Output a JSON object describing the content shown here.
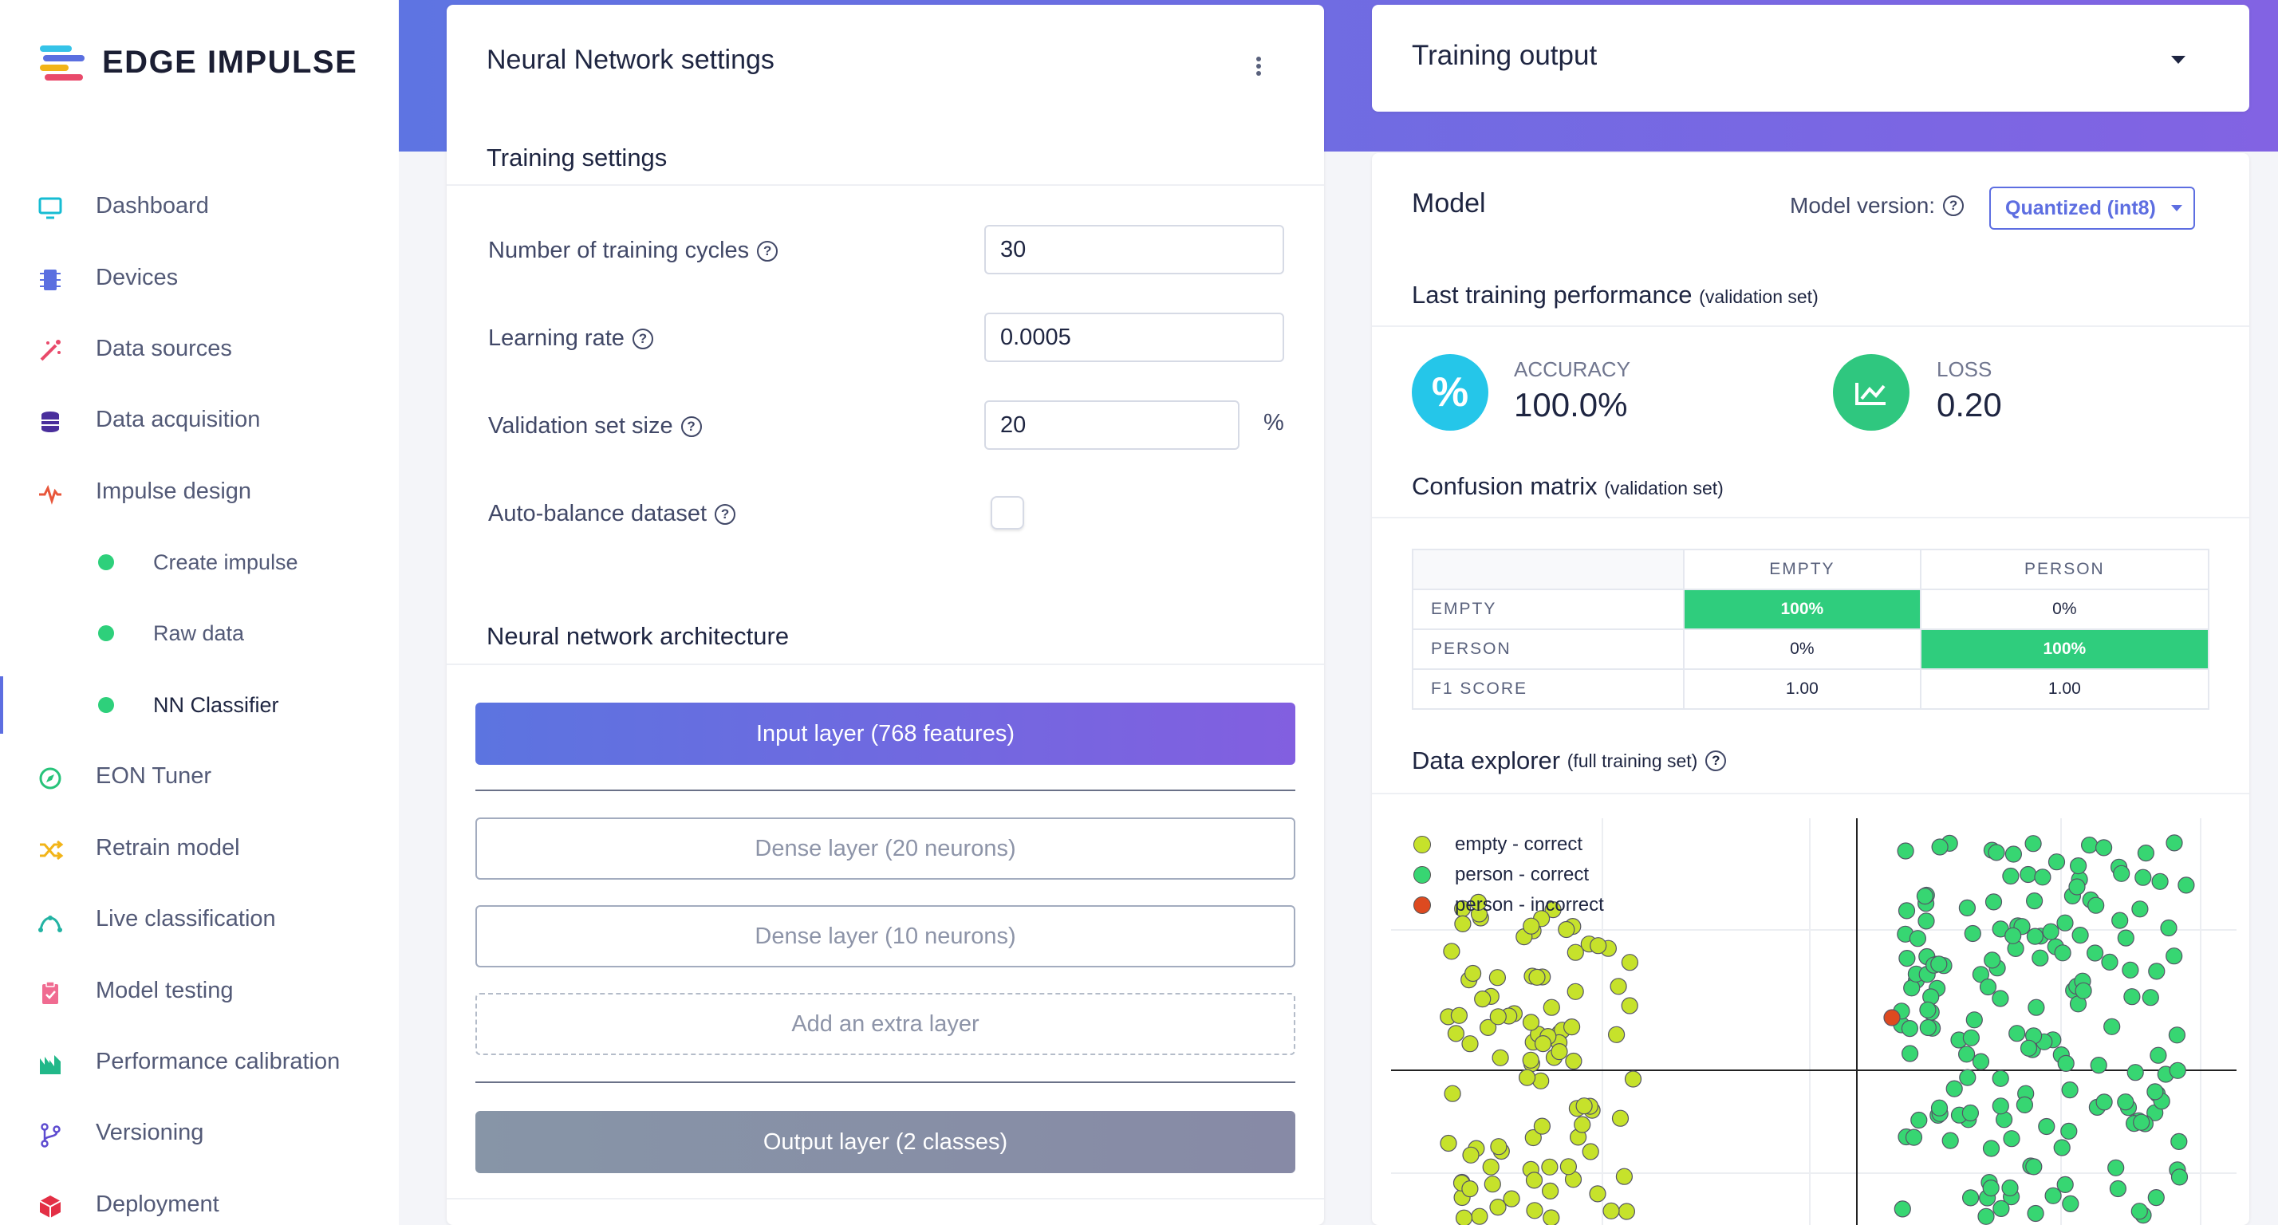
{
  "app": {
    "name": "EDGE IMPULSE"
  },
  "sidebar": {
    "items": [
      {
        "label": "Dashboard",
        "icon": "monitor-icon",
        "color": "#16bcd3"
      },
      {
        "label": "Devices",
        "icon": "chip-icon",
        "color": "#5b6fe0"
      },
      {
        "label": "Data sources",
        "icon": "magic-wand-icon",
        "color": "#e94a6b"
      },
      {
        "label": "Data acquisition",
        "icon": "database-icon",
        "color": "#4a2f9c"
      },
      {
        "label": "Impulse design",
        "icon": "pulse-icon",
        "color": "#e8563a"
      },
      {
        "label": "Create impulse",
        "sub": true
      },
      {
        "label": "Raw data",
        "sub": true
      },
      {
        "label": "NN Classifier",
        "sub": true,
        "active": true
      },
      {
        "label": "EON Tuner",
        "icon": "compass-icon",
        "color": "#27c37a"
      },
      {
        "label": "Retrain model",
        "icon": "shuffle-icon",
        "color": "#f2b418"
      },
      {
        "label": "Live classification",
        "icon": "curve-icon",
        "color": "#23b3a3"
      },
      {
        "label": "Model testing",
        "icon": "clipboard-icon",
        "color": "#f06b91"
      },
      {
        "label": "Performance calibration",
        "icon": "bar-chart-icon",
        "color": "#21b889"
      },
      {
        "label": "Versioning",
        "icon": "branch-icon",
        "color": "#5d4bd0"
      },
      {
        "label": "Deployment",
        "icon": "cube-icon",
        "color": "#e32f45"
      }
    ]
  },
  "nn": {
    "title": "Neural Network settings",
    "training_settings": "Training settings",
    "cycles_label": "Number of training cycles",
    "cycles_value": "30",
    "lr_label": "Learning rate",
    "lr_value": "0.0005",
    "val_label": "Validation set size",
    "val_value": "20",
    "val_unit": "%",
    "balance_label": "Auto-balance dataset",
    "arch_title": "Neural network architecture",
    "layers": {
      "input": "Input layer (768 features)",
      "dense1": "Dense layer (20 neurons)",
      "dense2": "Dense layer (10 neurons)",
      "add": "Add an extra layer",
      "output": "Output layer (2 classes)"
    }
  },
  "output": {
    "title": "Training output"
  },
  "model": {
    "title": "Model",
    "version_label": "Model version:",
    "version_value": "Quantized (int8)",
    "perf_title": "Last training performance",
    "perf_note": "(validation set)",
    "accuracy_label": "ACCURACY",
    "accuracy_value": "100.0%",
    "loss_label": "LOSS",
    "loss_value": "0.20",
    "cm_title": "Confusion matrix",
    "cm_note": "(validation set)",
    "cm": {
      "cols": [
        "EMPTY",
        "PERSON"
      ],
      "rows": [
        {
          "label": "EMPTY",
          "cells": [
            "100%",
            "0%"
          ]
        },
        {
          "label": "PERSON",
          "cells": [
            "0%",
            "100%"
          ]
        },
        {
          "label": "F1 SCORE",
          "cells": [
            "1.00",
            "1.00"
          ]
        }
      ]
    },
    "explorer_title": "Data explorer",
    "explorer_note": "(full training set)",
    "legend": [
      {
        "label": "empty - correct",
        "color": "#c6e22b"
      },
      {
        "label": "person - correct",
        "color": "#37d672"
      },
      {
        "label": "person - incorrect",
        "color": "#dd4a20"
      }
    ]
  },
  "colors": {
    "accent": "#5d6ee1",
    "green": "#2fcd7d"
  }
}
